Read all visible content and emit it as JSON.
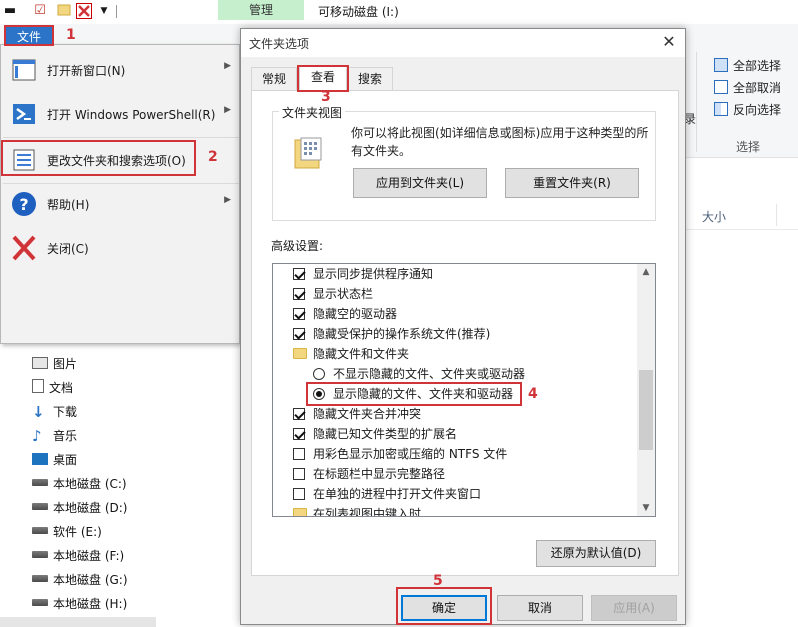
{
  "explorer": {
    "ribbon_context_tab": "管理",
    "window_title": "可移动磁盘 (I:)",
    "ribbon_buttons": [
      "全部选择",
      "全部取消",
      "反向选择"
    ],
    "ribbon_group_label": "选择",
    "ribbon_partial_text": "录",
    "column_header": "大小",
    "nav_items": [
      {
        "label": "图片",
        "icon": "pictures-icon"
      },
      {
        "label": "文档",
        "icon": "documents-icon"
      },
      {
        "label": "下载",
        "icon": "downloads-icon"
      },
      {
        "label": "音乐",
        "icon": "music-icon"
      },
      {
        "label": "桌面",
        "icon": "desktop-icon"
      },
      {
        "label": "本地磁盘 (C:)",
        "icon": "drive-icon"
      },
      {
        "label": "本地磁盘 (D:)",
        "icon": "drive-icon"
      },
      {
        "label": "软件 (E:)",
        "icon": "drive-icon"
      },
      {
        "label": "本地磁盘 (F:)",
        "icon": "drive-icon"
      },
      {
        "label": "本地磁盘 (G:)",
        "icon": "drive-icon"
      },
      {
        "label": "本地磁盘 (H:)",
        "icon": "drive-icon"
      }
    ]
  },
  "file_menu": {
    "button_label": "文件",
    "items": [
      {
        "label": "打开新窗口(N)",
        "icon": "new-window-icon",
        "has_submenu": true
      },
      {
        "label": "打开 Windows PowerShell(R)",
        "icon": "powershell-icon",
        "has_submenu": true
      },
      {
        "label": "更改文件夹和搜索选项(O)",
        "icon": "folder-options-icon",
        "has_submenu": false
      },
      {
        "label": "帮助(H)",
        "icon": "help-icon",
        "has_submenu": true
      },
      {
        "label": "关闭(C)",
        "icon": "close-x-icon",
        "has_submenu": false
      }
    ]
  },
  "dialog": {
    "title": "文件夹选项",
    "close_glyph": "✕",
    "tabs": [
      "常规",
      "查看",
      "搜索"
    ],
    "active_tab": "查看",
    "folder_view": {
      "title": "文件夹视图",
      "description": "你可以将此视图(如详细信息或图标)应用于这种类型的所有文件夹。",
      "apply_button": "应用到文件夹(L)",
      "reset_button": "重置文件夹(R)"
    },
    "advanced_label": "高级设置:",
    "advanced_items": [
      {
        "type": "checkbox",
        "checked": true,
        "label": "显示同步提供程序通知"
      },
      {
        "type": "checkbox",
        "checked": true,
        "label": "显示状态栏"
      },
      {
        "type": "checkbox",
        "checked": true,
        "label": "隐藏空的驱动器"
      },
      {
        "type": "checkbox",
        "checked": true,
        "label": "隐藏受保护的操作系统文件(推荐)"
      },
      {
        "type": "folder",
        "label": "隐藏文件和文件夹"
      },
      {
        "type": "radio",
        "checked": false,
        "label": "不显示隐藏的文件、文件夹或驱动器"
      },
      {
        "type": "radio",
        "checked": true,
        "label": "显示隐藏的文件、文件夹和驱动器"
      },
      {
        "type": "checkbox",
        "checked": true,
        "label": "隐藏文件夹合并冲突"
      },
      {
        "type": "checkbox",
        "checked": true,
        "label": "隐藏已知文件类型的扩展名"
      },
      {
        "type": "checkbox",
        "checked": false,
        "label": "用彩色显示加密或压缩的 NTFS 文件"
      },
      {
        "type": "checkbox",
        "checked": false,
        "label": "在标题栏中显示完整路径"
      },
      {
        "type": "checkbox",
        "checked": false,
        "label": "在单独的进程中打开文件夹窗口"
      },
      {
        "type": "folder",
        "label": "在列表视图中键入时"
      }
    ],
    "restore_defaults_button": "还原为默认值(D)",
    "ok_button": "确定",
    "cancel_button": "取消",
    "apply_button": "应用(A)"
  },
  "annotations": {
    "step1": "1",
    "step2": "2",
    "step3": "3",
    "step4": "4",
    "step5": "5",
    "color": "#d13438"
  }
}
